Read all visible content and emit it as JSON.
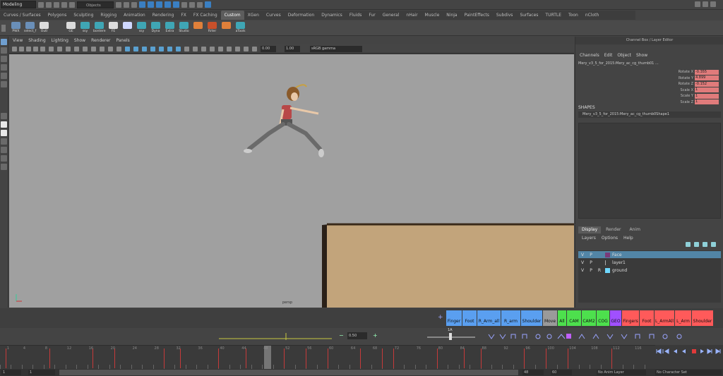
{
  "status": {
    "mode": "Modeling",
    "objects_field": "Objects"
  },
  "shelf_tabs": [
    "Curves / Surfaces",
    "Polygons",
    "Sculpting",
    "Rigging",
    "Animation",
    "Rendering",
    "FX",
    "FX Caching",
    "Custom",
    "XGen",
    "Curves",
    "Deformation",
    "Dynamics",
    "Fluids",
    "Fur",
    "General",
    "nHair",
    "Muscle",
    "Ninja",
    "PaintEffects",
    "Subdivs",
    "Surfaces",
    "TURTLE",
    "Toon",
    "nCloth"
  ],
  "active_shelf_tab": "Custom",
  "shelf_buttons": [
    {
      "label": "PWX",
      "color": "#6a8fb8"
    },
    {
      "label": "select_f",
      "color": "#6a8fb8"
    },
    {
      "label": "Outl",
      "color": "#dcdcdc"
    },
    {
      "label": "GE",
      "color": "#dcdcdc"
    },
    {
      "label": "ssy",
      "color": "#3fa6b5"
    },
    {
      "label": "bontere",
      "color": "#3fa6b5"
    },
    {
      "label": "FE",
      "color": "#dcdcdc"
    },
    {
      "label": "",
      "color": "#cfd8ff"
    },
    {
      "label": "ssy",
      "color": "#3fa6b5"
    },
    {
      "label": "Dyna",
      "color": "#3fa6b5"
    },
    {
      "label": "Extra",
      "color": "#3fa6b5"
    },
    {
      "label": "Studio",
      "color": "#3fa6b5"
    },
    {
      "label": "",
      "color": "#e0803a"
    },
    {
      "label": "Rrter",
      "color": "#c8502a"
    },
    {
      "label": "",
      "color": "#e0803a"
    },
    {
      "label": "aTools",
      "color": "#3fa6b5"
    }
  ],
  "panel_menu": [
    "View",
    "Shading",
    "Lighting",
    "Show",
    "Renderer",
    "Panels"
  ],
  "panel_bar": {
    "value_a": "0.00",
    "value_b": "1.00",
    "color_space": "sRGB gamma"
  },
  "viewport": {
    "camera_label": "persp"
  },
  "channel_box": {
    "title": "Channel Box / Layer Editor",
    "menu": [
      "Channels",
      "Edit",
      "Object",
      "Show"
    ],
    "object_name": "Mery_v3_5_for_2015:Mery_ac_cg_thumb01 ...",
    "attributes": [
      {
        "name": "Rotate X",
        "value": "-0.355"
      },
      {
        "name": "Rotate Y",
        "value": "4.899"
      },
      {
        "name": "Rotate Z",
        "value": "-0.152"
      },
      {
        "name": "Scale X",
        "value": "1"
      },
      {
        "name": "Scale Y",
        "value": "1"
      },
      {
        "name": "Scale Z",
        "value": "1"
      }
    ],
    "shapes_header": "SHAPES",
    "shape_name": "Mery_v3_5_for_2015:Mery_ac_cg_thumb0Shape1"
  },
  "layer_editor": {
    "tabs": [
      "Display",
      "Render",
      "Anim"
    ],
    "active_tab": "Display",
    "menu": [
      "Layers",
      "Options",
      "Help"
    ],
    "layers": [
      {
        "v": "V",
        "p": "P",
        "r": "",
        "name": "Face",
        "color": "#7a3a7a",
        "selected": true
      },
      {
        "v": "V",
        "p": "P",
        "r": "",
        "name": "layer1",
        "color": "",
        "selected": false
      },
      {
        "v": "V",
        "p": "P",
        "r": "R",
        "name": "ground",
        "color": "#6fd8ff",
        "selected": false
      }
    ]
  },
  "char_buttons": [
    {
      "label": "Finger",
      "color": "#5a9ff0"
    },
    {
      "label": "Foot",
      "color": "#5a9ff0"
    },
    {
      "label": "R_Arm_all",
      "color": "#5a9ff0"
    },
    {
      "label": "R_arm",
      "color": "#5a9ff0"
    },
    {
      "label": "Shoulder",
      "color": "#5a9ff0"
    },
    {
      "label": "Move",
      "color": "#9a9a9a"
    },
    {
      "label": "All",
      "color": "#4de04d"
    },
    {
      "label": "CAM",
      "color": "#4de04d"
    },
    {
      "label": "CAM2",
      "color": "#4de04d"
    },
    {
      "label": "COG",
      "color": "#4de04d"
    },
    {
      "label": "GEO",
      "color": "#a050ff"
    },
    {
      "label": "Fingers",
      "color": "#ff5a5a"
    },
    {
      "label": "Foot",
      "color": "#ff5a5a"
    },
    {
      "label": "L_ArmAll",
      "color": "#ff5a5a"
    },
    {
      "label": "L_Arm",
      "color": "#ff5a5a"
    },
    {
      "label": "Shoulder",
      "color": "#ff5a5a"
    }
  ],
  "anim_bar": {
    "value": "0.50",
    "label": "1A"
  },
  "timeline": {
    "tick_labels": [
      "1",
      "4",
      "8",
      "12",
      "16",
      "20",
      "24",
      "28",
      "32",
      "36",
      "40",
      "44",
      "48",
      "52",
      "56",
      "60",
      "64",
      "68",
      "72",
      "76",
      "80",
      "84",
      "88",
      "92",
      "96",
      "100",
      "104",
      "108",
      "112",
      "116",
      "120"
    ],
    "current_frame": "49"
  },
  "range_bar": {
    "start": "1",
    "end": "1",
    "range_end": "48",
    "anim_end": "60",
    "layer": "No Anim Layer",
    "character": "No Character Set"
  }
}
